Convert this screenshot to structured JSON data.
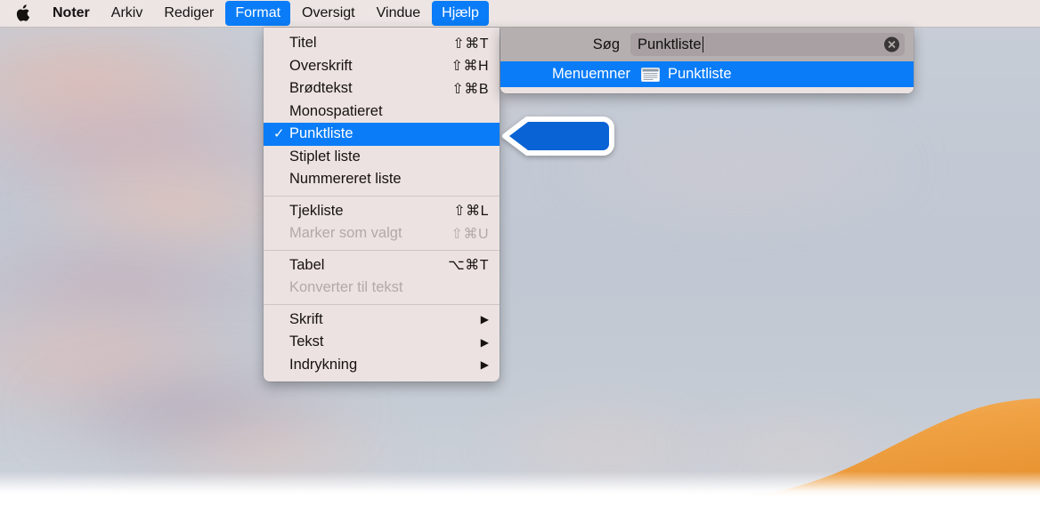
{
  "menubar": {
    "apple_icon": "apple-logo-icon",
    "items": [
      {
        "label": "Noter",
        "bold": true,
        "active": false
      },
      {
        "label": "Arkiv",
        "bold": false,
        "active": false
      },
      {
        "label": "Rediger",
        "bold": false,
        "active": false
      },
      {
        "label": "Format",
        "bold": false,
        "active": true
      },
      {
        "label": "Oversigt",
        "bold": false,
        "active": false
      },
      {
        "label": "Vindue",
        "bold": false,
        "active": false
      },
      {
        "label": "Hjælp",
        "bold": false,
        "active": true
      }
    ]
  },
  "format_menu": {
    "items": [
      {
        "type": "item",
        "label": "Titel",
        "shortcut": "⇧⌘T",
        "checked": false,
        "disabled": false,
        "submenu": false
      },
      {
        "type": "item",
        "label": "Overskrift",
        "shortcut": "⇧⌘H",
        "checked": false,
        "disabled": false,
        "submenu": false
      },
      {
        "type": "item",
        "label": "Brødtekst",
        "shortcut": "⇧⌘B",
        "checked": false,
        "disabled": false,
        "submenu": false
      },
      {
        "type": "item",
        "label": "Monospatieret",
        "shortcut": "",
        "checked": false,
        "disabled": false,
        "submenu": false
      },
      {
        "type": "item",
        "label": "Punktliste",
        "shortcut": "",
        "checked": true,
        "disabled": false,
        "submenu": false,
        "selected": true
      },
      {
        "type": "item",
        "label": "Stiplet liste",
        "shortcut": "",
        "checked": false,
        "disabled": false,
        "submenu": false
      },
      {
        "type": "item",
        "label": "Nummereret liste",
        "shortcut": "",
        "checked": false,
        "disabled": false,
        "submenu": false
      },
      {
        "type": "separator"
      },
      {
        "type": "item",
        "label": "Tjekliste",
        "shortcut": "⇧⌘L",
        "checked": false,
        "disabled": false,
        "submenu": false
      },
      {
        "type": "item",
        "label": "Marker som valgt",
        "shortcut": "⇧⌘U",
        "checked": false,
        "disabled": true,
        "submenu": false
      },
      {
        "type": "separator"
      },
      {
        "type": "item",
        "label": "Tabel",
        "shortcut": "⌥⌘T",
        "checked": false,
        "disabled": false,
        "submenu": false
      },
      {
        "type": "item",
        "label": "Konverter til tekst",
        "shortcut": "",
        "checked": false,
        "disabled": true,
        "submenu": false
      },
      {
        "type": "separator"
      },
      {
        "type": "item",
        "label": "Skrift",
        "shortcut": "",
        "checked": false,
        "disabled": false,
        "submenu": true
      },
      {
        "type": "item",
        "label": "Tekst",
        "shortcut": "",
        "checked": false,
        "disabled": false,
        "submenu": true
      },
      {
        "type": "item",
        "label": "Indrykning",
        "shortcut": "",
        "checked": false,
        "disabled": false,
        "submenu": true
      }
    ],
    "checkmark_glyph": "✓",
    "submenu_glyph": "▶"
  },
  "help_search": {
    "label": "Søg",
    "value": "Punktliste",
    "placeholder": "Søg",
    "clear_icon": "clear-circle-icon",
    "results": [
      {
        "category": "Menuemner",
        "icon": "menu-item-icon",
        "title": "Punktliste",
        "selected": true
      }
    ]
  },
  "callout": {
    "name": "pointer-arrow-callout",
    "fill": "#0a63d4",
    "border": "#ffffff"
  },
  "colors": {
    "accent_blue": "#0a7cf7",
    "menubar_bg": "#ece5e4",
    "menu_bg": "#ebe2e1",
    "search_head_bg": "#b6afaf",
    "dune_orange": "#f0a33f"
  }
}
